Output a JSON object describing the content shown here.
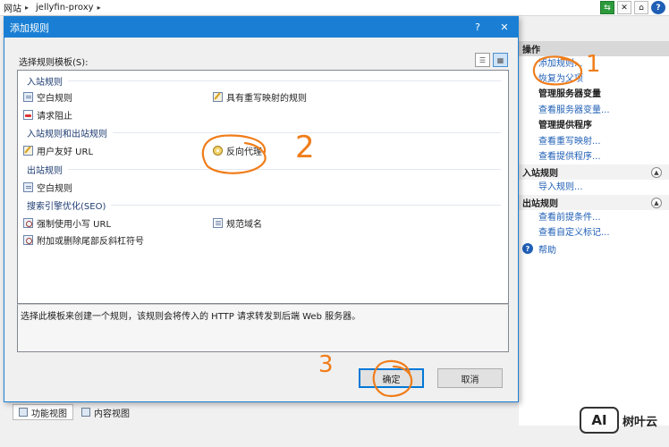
{
  "address_bar": {
    "crumbs": [
      "网站",
      "jellyfin-proxy"
    ]
  },
  "dialog": {
    "title": "添加规则",
    "help_button": "?",
    "close_button": "✕",
    "template_label": "选择规则模板(S):",
    "groups": [
      {
        "header": "入站规则",
        "items": [
          {
            "label": "空白规则",
            "icon": "blank-rule-icon"
          },
          {
            "label": "请求阻止",
            "icon": "request-block-icon"
          },
          {
            "label": "具有重写映射的规则",
            "icon": "rewrite-map-icon"
          }
        ]
      },
      {
        "header": "入站规则和出站规则",
        "items": [
          {
            "label": "用户友好 URL",
            "icon": "friendly-url-icon"
          },
          {
            "label": "反向代理",
            "icon": "reverse-proxy-icon"
          }
        ]
      },
      {
        "header": "出站规则",
        "items": [
          {
            "label": "空白规则",
            "icon": "blank-rule-icon"
          }
        ]
      },
      {
        "header": "搜索引擎优化(SEO)",
        "items": [
          {
            "label": "强制使用小写 URL",
            "icon": "lowercase-url-icon"
          },
          {
            "label": "附加或删除尾部反斜杠符号",
            "icon": "trailing-slash-icon"
          },
          {
            "label": "规范域名",
            "icon": "canonical-domain-icon"
          }
        ]
      }
    ],
    "description": "选择此模板来创建一个规则，该规则会将传入的 HTTP 请求转发到后端 Web 服务器。",
    "ok_label": "确定",
    "cancel_label": "取消"
  },
  "actions_panel": {
    "header": "操作",
    "links_top": [
      "添加规则...",
      "恢复为父项"
    ],
    "sections": [
      {
        "title": "管理服务器变量",
        "links": [
          "查看服务器变量..."
        ]
      },
      {
        "title": "管理提供程序",
        "links": [
          "查看重写映射...",
          "查看提供程序..."
        ]
      }
    ],
    "inbound_header": "入站规则",
    "inbound_links": [
      "导入规则..."
    ],
    "outbound_header": "出站规则",
    "outbound_links": [
      "查看前提条件...",
      "查看自定义标记..."
    ],
    "help": "帮助"
  },
  "bottom_tabs": [
    "功能视图",
    "内容视图"
  ],
  "watermark": {
    "logo": "AI",
    "text": "树叶云"
  },
  "annotations": [
    "1",
    "2",
    "3"
  ],
  "colors": {
    "titlebar": "#1a7fd4",
    "link": "#1f5fb5",
    "annotation": "#f07d1a"
  }
}
